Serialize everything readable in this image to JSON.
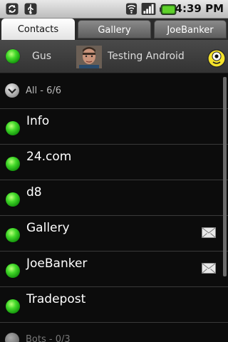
{
  "status_bar": {
    "time": "4:39 PM"
  },
  "tabs": [
    {
      "label": "Contacts",
      "active": true
    },
    {
      "label": "Gallery",
      "active": false
    },
    {
      "label": "JoeBanker",
      "active": false
    }
  ],
  "profile": {
    "name": "Gus",
    "status_message": "Testing Android"
  },
  "groups": [
    {
      "label": "All - 6/6"
    },
    {
      "label": "Bots - 0/3"
    }
  ],
  "contacts": [
    {
      "name": "Info",
      "has_message": false
    },
    {
      "name": "24.com",
      "has_message": false
    },
    {
      "name": "d8",
      "has_message": false
    },
    {
      "name": "Gallery",
      "has_message": true
    },
    {
      "name": "JoeBanker",
      "has_message": true
    },
    {
      "name": "Tradepost",
      "has_message": false
    }
  ],
  "colors": {
    "online": "#43d92a",
    "background": "#0c0c0c",
    "tab_active": "#ffffff"
  }
}
